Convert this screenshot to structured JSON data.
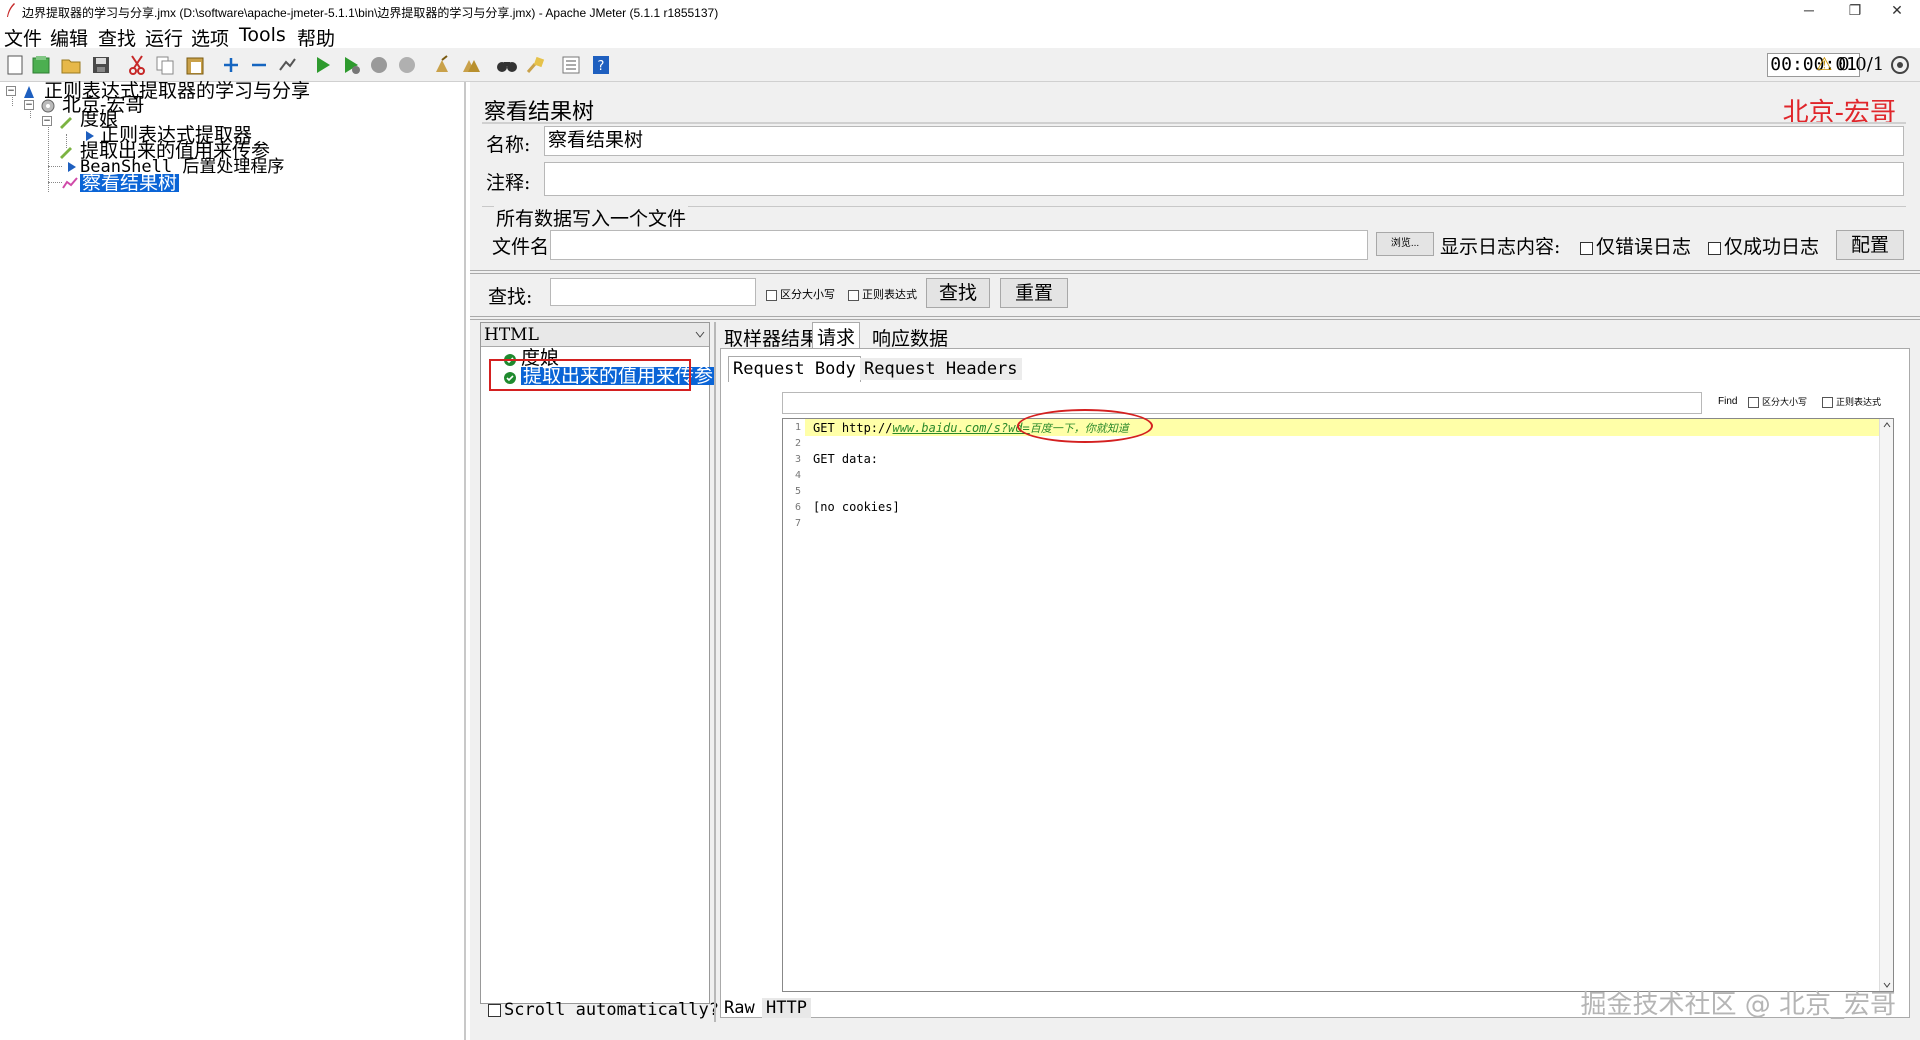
{
  "window": {
    "title": "边界提取器的学习与分享.jmx (D:\\software\\apache-jmeter-5.1.1\\bin\\边界提取器的学习与分享.jmx) - Apache JMeter (5.1.1 r1855137)",
    "minimize": "─",
    "restore": "❐",
    "close": "✕"
  },
  "menu": [
    "文件",
    "编辑",
    "查找",
    "运行",
    "选项",
    "Tools",
    "帮助"
  ],
  "toolbar": {
    "timer": "00:00:01",
    "warn_icon": "⚠",
    "counts": "0  0/1"
  },
  "tree": {
    "root": "正则表达式提取器的学习与分享",
    "thread_group": "北京-宏哥",
    "sampler": "度娘",
    "extractor": "正则表达式提取器",
    "sampler2": "提取出来的值用来传参",
    "postproc": "BeanShell 后置处理程序",
    "listener": "察看结果树"
  },
  "panel": {
    "title": "察看结果树",
    "brand": "北京-宏哥",
    "name_label": "名称:",
    "name_value": "察看结果树",
    "comment_label": "注释:",
    "comment_value": "",
    "file_section": "所有数据写入一个文件",
    "filename_label": "文件名",
    "filename_value": "",
    "browse": "浏览...",
    "log_label": "显示日志内容:",
    "errors_only": "仅错误日志",
    "success_only": "仅成功日志",
    "configure": "配置",
    "search_label": "查找:",
    "search_value": "",
    "case_sensitive": "区分大小写",
    "regex": "正则表达式",
    "find_button": "查找",
    "reset_button": "重置"
  },
  "results": {
    "renderer": "HTML",
    "items": [
      "度娘",
      "提取出来的值用来传参"
    ],
    "scroll_auto": "Scroll automatically?",
    "tabs": [
      "取样器结果",
      "请求",
      "响应数据"
    ],
    "subtabs": [
      "Request Body",
      "Request Headers"
    ],
    "find_label": "Find",
    "find_case": "区分大小写",
    "find_regex": "正则表达式",
    "bottom_tabs": [
      "Raw",
      "HTTP"
    ]
  },
  "code": {
    "line_numbers": [
      "1",
      "2",
      "3",
      "4",
      "5",
      "6",
      "7"
    ],
    "line1_prefix": "GET http://",
    "line1_url": "www.baidu.com/s?wd=",
    "line1_query": "百度一下，你就知道",
    "line3": "GET data:",
    "line6": "[no cookies]"
  },
  "watermark": "掘金技术社区 @ 北京_宏哥",
  "colors": {
    "selection": "#0a64d6",
    "brand_red": "#e0262b",
    "annotation_red": "#d42020",
    "highlight_line": "#ffffa8",
    "url_green": "#2b8a2b"
  }
}
